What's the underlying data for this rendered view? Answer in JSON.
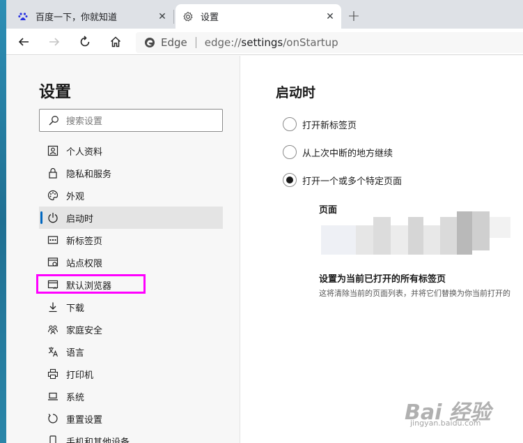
{
  "tabs": [
    {
      "title": "百度一下，你就知道",
      "active": false,
      "icon": "baidu-paw-icon"
    },
    {
      "title": "设置",
      "active": true,
      "icon": "gear-icon"
    }
  ],
  "toolbar": {
    "site_name": "Edge",
    "url_prefix": "edge://",
    "url_host": "settings",
    "url_path": "/onStartup"
  },
  "sidebar": {
    "title": "设置",
    "search_placeholder": "搜索设置",
    "items": [
      {
        "label": "个人资料",
        "icon": "profile-icon"
      },
      {
        "label": "隐私和服务",
        "icon": "lock-icon"
      },
      {
        "label": "外观",
        "icon": "palette-icon"
      },
      {
        "label": "启动时",
        "icon": "power-icon",
        "selected": true
      },
      {
        "label": "新标签页",
        "icon": "new-tab-icon"
      },
      {
        "label": "站点权限",
        "icon": "site-permissions-icon"
      },
      {
        "label": "默认浏览器",
        "icon": "default-browser-icon",
        "highlighted": true
      },
      {
        "label": "下载",
        "icon": "download-icon"
      },
      {
        "label": "家庭安全",
        "icon": "family-icon"
      },
      {
        "label": "语言",
        "icon": "language-icon"
      },
      {
        "label": "打印机",
        "icon": "printer-icon"
      },
      {
        "label": "系统",
        "icon": "laptop-icon"
      },
      {
        "label": "重置设置",
        "icon": "reset-icon"
      },
      {
        "label": "手机和其他设备",
        "icon": "phone-icon"
      }
    ]
  },
  "main": {
    "section_title": "启动时",
    "options": [
      {
        "label": "打开新标签页",
        "checked": false
      },
      {
        "label": "从上次中断的地方继续",
        "checked": false
      },
      {
        "label": "打开一个或多个特定页面",
        "checked": true
      }
    ],
    "pages_label": "页面",
    "current_tabs_title": "设置为当前已打开的所有标签页",
    "current_tabs_desc": "这将清除当前的页面列表，并将它们替换为你当前打开的"
  },
  "watermark": {
    "logo_text": "Bai  经验",
    "url": "jingyan.baidu.com"
  },
  "colors": {
    "accent": "#0067c0",
    "highlight": "#ff00ff"
  }
}
